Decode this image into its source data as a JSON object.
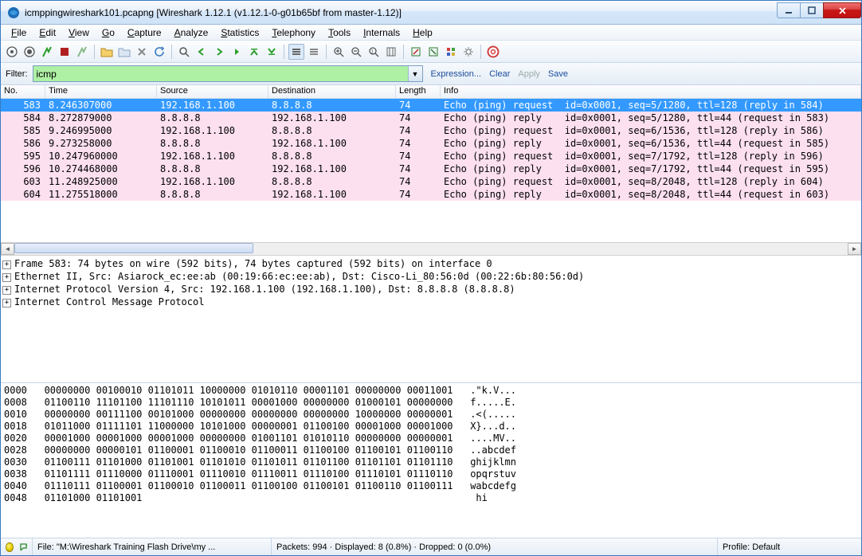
{
  "window": {
    "title": "icmppingwireshark101.pcapng    [Wireshark 1.12.1  (v1.12.1-0-g01b65bf from master-1.12)]"
  },
  "menu": [
    "File",
    "Edit",
    "View",
    "Go",
    "Capture",
    "Analyze",
    "Statistics",
    "Telephony",
    "Tools",
    "Internals",
    "Help"
  ],
  "filter": {
    "label": "Filter:",
    "value": "icmp",
    "expression": "Expression...",
    "clear": "Clear",
    "apply": "Apply",
    "save": "Save"
  },
  "columns": {
    "no": "No.",
    "time": "Time",
    "src": "Source",
    "dst": "Destination",
    "len": "Length",
    "info": "Info"
  },
  "packets": [
    {
      "sel": true,
      "pink": false,
      "no": "583",
      "time": "8.246307000",
      "src": "192.168.1.100",
      "dst": "8.8.8.8",
      "len": "74",
      "info": "Echo (ping) request  id=0x0001, seq=5/1280, ttl=128 (reply in 584)"
    },
    {
      "sel": false,
      "pink": true,
      "no": "584",
      "time": "8.272879000",
      "src": "8.8.8.8",
      "dst": "192.168.1.100",
      "len": "74",
      "info": "Echo (ping) reply    id=0x0001, seq=5/1280, ttl=44 (request in 583)"
    },
    {
      "sel": false,
      "pink": true,
      "no": "585",
      "time": "9.246995000",
      "src": "192.168.1.100",
      "dst": "8.8.8.8",
      "len": "74",
      "info": "Echo (ping) request  id=0x0001, seq=6/1536, ttl=128 (reply in 586)"
    },
    {
      "sel": false,
      "pink": true,
      "no": "586",
      "time": "9.273258000",
      "src": "8.8.8.8",
      "dst": "192.168.1.100",
      "len": "74",
      "info": "Echo (ping) reply    id=0x0001, seq=6/1536, ttl=44 (request in 585)"
    },
    {
      "sel": false,
      "pink": true,
      "no": "595",
      "time": "10.247960000",
      "src": "192.168.1.100",
      "dst": "8.8.8.8",
      "len": "74",
      "info": "Echo (ping) request  id=0x0001, seq=7/1792, ttl=128 (reply in 596)"
    },
    {
      "sel": false,
      "pink": true,
      "no": "596",
      "time": "10.274468000",
      "src": "8.8.8.8",
      "dst": "192.168.1.100",
      "len": "74",
      "info": "Echo (ping) reply    id=0x0001, seq=7/1792, ttl=44 (request in 595)"
    },
    {
      "sel": false,
      "pink": true,
      "no": "603",
      "time": "11.248925000",
      "src": "192.168.1.100",
      "dst": "8.8.8.8",
      "len": "74",
      "info": "Echo (ping) request  id=0x0001, seq=8/2048, ttl=128 (reply in 604)"
    },
    {
      "sel": false,
      "pink": true,
      "no": "604",
      "time": "11.275518000",
      "src": "8.8.8.8",
      "dst": "192.168.1.100",
      "len": "74",
      "info": "Echo (ping) reply    id=0x0001, seq=8/2048, ttl=44 (request in 603)"
    }
  ],
  "details": [
    "Frame 583: 74 bytes on wire (592 bits), 74 bytes captured (592 bits) on interface 0",
    "Ethernet II, Src: Asiarock_ec:ee:ab (00:19:66:ec:ee:ab), Dst: Cisco-Li_80:56:0d (00:22:6b:80:56:0d)",
    "Internet Protocol Version 4, Src: 192.168.1.100 (192.168.1.100), Dst: 8.8.8.8 (8.8.8.8)",
    "Internet Control Message Protocol"
  ],
  "bytes": [
    "0000   00000000 00100010 01101011 10000000 01010110 00001101 00000000 00011001   .\"k.V...",
    "0008   01100110 11101100 11101110 10101011 00001000 00000000 01000101 00000000   f.....E.",
    "0010   00000000 00111100 00101000 00000000 00000000 00000000 10000000 00000001   .<(.....",
    "0018   01011000 01111101 11000000 10101000 00000001 01100100 00001000 00001000   X}...d..",
    "0020   00001000 00001000 00001000 00000000 01001101 01010110 00000000 00000001   ....MV..",
    "0028   00000000 00000101 01100001 01100010 01100011 01100100 01100101 01100110   ..abcdef",
    "0030   01100111 01101000 01101001 01101010 01101011 01101100 01101101 01101110   ghijklmn",
    "0038   01101111 01110000 01110001 01110010 01110011 01110100 01110101 01110110   opqrstuv",
    "0040   01110111 01100001 01100010 01100011 01100100 01100101 01100110 01100111   wabcdefg",
    "0048   01101000 01101001                                                          hi"
  ],
  "status": {
    "file": "File: \"M:\\Wireshark Training Flash Drive\\my ...",
    "counts": "Packets: 994 · Displayed: 8 (0.8%) · Dropped: 0 (0.0%)",
    "profile": "Profile: Default"
  }
}
